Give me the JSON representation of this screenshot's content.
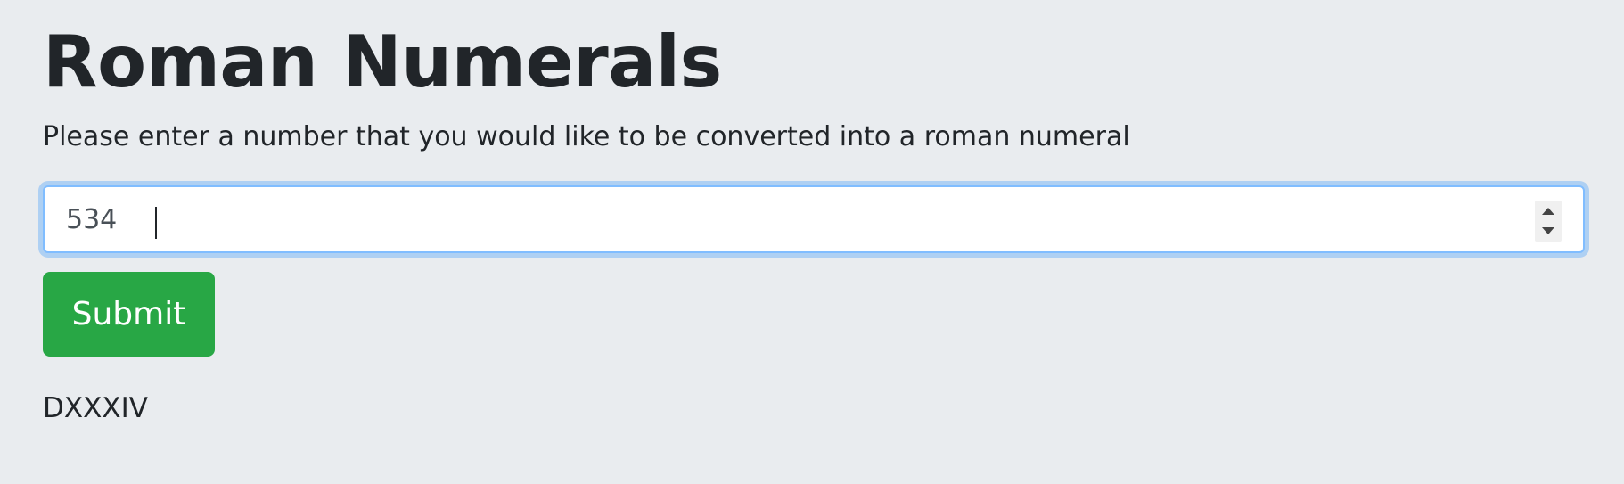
{
  "header": {
    "title": "Roman Numerals"
  },
  "form": {
    "instructions": "Please enter a number that you would like to be converted into a roman numeral",
    "number_input": {
      "value": "534",
      "placeholder": ""
    },
    "submit_label": "Submit"
  },
  "result": {
    "text": "DXXXIV"
  },
  "colors": {
    "background": "#e9ecef",
    "submit_button": "#28a745",
    "focus_border": "#80bdff"
  }
}
